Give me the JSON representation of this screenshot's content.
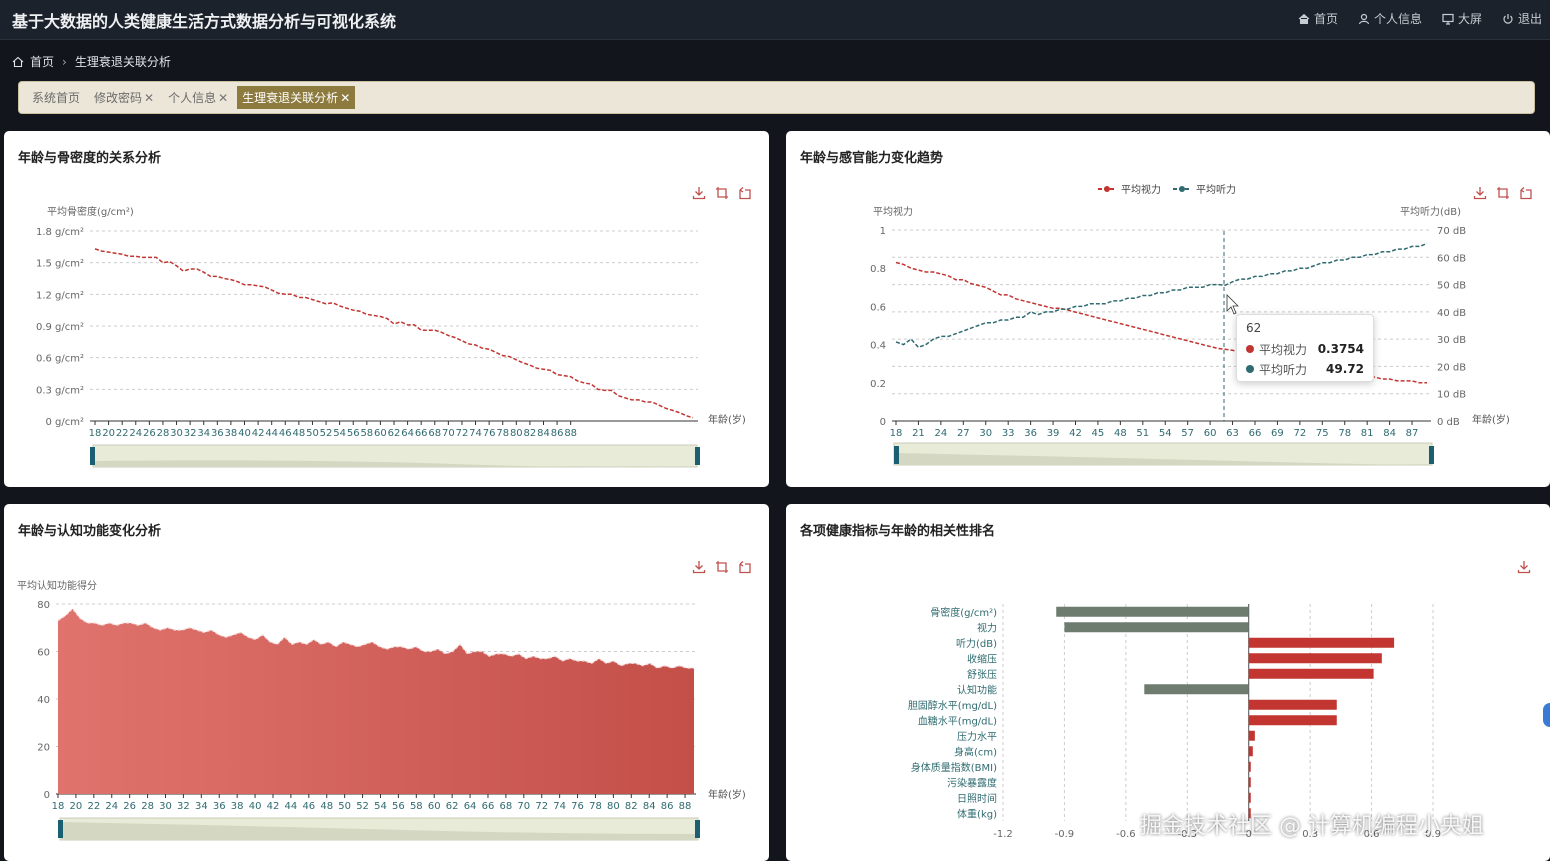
{
  "app": {
    "title": "基于大数据的人类健康生活方式数据分析与可视化系统"
  },
  "topnav": {
    "home": "首页",
    "profile": "个人信息",
    "screen": "大屏",
    "logout": "退出"
  },
  "breadcrumb": {
    "home": "首页",
    "current": "生理衰退关联分析"
  },
  "tabs": [
    {
      "label": "系统首页",
      "closable": false,
      "active": false
    },
    {
      "label": "修改密码",
      "closable": true,
      "active": false
    },
    {
      "label": "个人信息",
      "closable": true,
      "active": false
    },
    {
      "label": "生理衰退关联分析",
      "closable": true,
      "active": true
    }
  ],
  "colors": {
    "red": "#c23531",
    "teal": "#2f6b70",
    "gray": "#6e7c70",
    "area": "#cd5c5c",
    "slider": "#e8ebd7",
    "handle": "#1c5f70"
  },
  "panels": {
    "bone": {
      "title": "年龄与骨密度的关系分析"
    },
    "sense": {
      "title": "年龄与感官能力变化趋势"
    },
    "cog": {
      "title": "年龄与认知功能变化分析"
    },
    "corr": {
      "title": "各项健康指标与年龄的相关性排名"
    }
  },
  "tooltip": {
    "age": "62",
    "vision_name": "平均视力",
    "vision_value": "0.3754",
    "hearing_name": "平均听力",
    "hearing_value": "49.72"
  },
  "watermark": "掘金技术社区 @ 计算机编程小央姐",
  "chart_data": [
    {
      "type": "line",
      "title": "年龄与骨密度的关系分析",
      "xlabel": "年龄(岁)",
      "ylabel": "平均骨密度(g/cm²)",
      "x_start": 18,
      "x_end": 89,
      "x_tick_labels": [
        "18",
        "20",
        "22",
        "24",
        "26",
        "28",
        "30",
        "32",
        "34",
        "36",
        "38",
        "40",
        "42",
        "44",
        "46",
        "48",
        "50",
        "52",
        "54",
        "56",
        "58",
        "60",
        "62",
        "64",
        "66",
        "68",
        "70",
        "72",
        "74",
        "76",
        "78",
        "80",
        "82",
        "84",
        "86",
        "88"
      ],
      "ylim": [
        0,
        1.8
      ],
      "y_tick_labels": [
        "0 g/cm²",
        "0.3 g/cm²",
        "0.6 g/cm²",
        "0.9 g/cm²",
        "1.2 g/cm²",
        "1.5 g/cm²",
        "1.8 g/cm²"
      ],
      "series": [
        {
          "values": [
            1.63,
            1.61,
            1.6,
            1.59,
            1.58,
            1.56,
            1.56,
            1.55,
            1.55,
            1.55,
            1.5,
            1.51,
            1.47,
            1.42,
            1.44,
            1.44,
            1.41,
            1.37,
            1.37,
            1.35,
            1.34,
            1.32,
            1.29,
            1.29,
            1.28,
            1.27,
            1.24,
            1.21,
            1.2,
            1.2,
            1.17,
            1.17,
            1.15,
            1.13,
            1.11,
            1.12,
            1.09,
            1.07,
            1.05,
            1.04,
            1.01,
            1.0,
            0.99,
            0.97,
            0.92,
            0.94,
            0.91,
            0.91,
            0.86,
            0.86,
            0.86,
            0.84,
            0.81,
            0.79,
            0.76,
            0.73,
            0.72,
            0.69,
            0.68,
            0.65,
            0.62,
            0.61,
            0.58,
            0.55,
            0.53,
            0.5,
            0.49,
            0.48,
            0.44,
            0.43,
            0.42,
            0.38,
            0.36,
            0.35,
            0.3,
            0.29,
            0.29,
            0.24,
            0.22,
            0.2,
            0.2,
            0.18,
            0.18,
            0.15,
            0.12,
            0.1,
            0.08,
            0.05,
            0.03
          ]
        }
      ],
      "grid": true
    },
    {
      "type": "line",
      "title": "年龄与感官能力变化趋势",
      "xlabel": "年龄(岁)",
      "ylabel": "平均视力",
      "y2label": "平均听力(dB)",
      "x_start": 18,
      "x_end": 89,
      "x_tick_labels": [
        "18",
        "21",
        "24",
        "27",
        "30",
        "33",
        "36",
        "39",
        "42",
        "45",
        "48",
        "51",
        "54",
        "57",
        "60",
        "63",
        "66",
        "69",
        "72",
        "75",
        "78",
        "81",
        "84",
        "87"
      ],
      "ylim": [
        0,
        1
      ],
      "y_tick_labels": [
        "0",
        "0.2",
        "0.4",
        "0.6",
        "0.8",
        "1"
      ],
      "y2lim": [
        0,
        70
      ],
      "y2_tick_labels": [
        "0 dB",
        "10 dB",
        "20 dB",
        "30 dB",
        "40 dB",
        "50 dB",
        "60 dB",
        "70 dB"
      ],
      "legend": "top-center",
      "series": [
        {
          "name": "平均视力",
          "axis": "left",
          "values": [
            0.83,
            0.82,
            0.8,
            0.79,
            0.78,
            0.78,
            0.77,
            0.76,
            0.74,
            0.74,
            0.72,
            0.71,
            0.7,
            0.68,
            0.66,
            0.66,
            0.64,
            0.63,
            0.62,
            0.61,
            0.6,
            0.59,
            0.59,
            0.58,
            0.57,
            0.56,
            0.55,
            0.54,
            0.53,
            0.52,
            0.51,
            0.5,
            0.49,
            0.48,
            0.47,
            0.46,
            0.45,
            0.44,
            0.43,
            0.42,
            0.41,
            0.4,
            0.39,
            0.38,
            0.3754,
            0.37,
            0.36,
            0.35,
            0.34,
            0.33,
            0.32,
            0.31,
            0.3,
            0.3,
            0.29,
            0.28,
            0.27,
            0.27,
            0.26,
            0.25,
            0.25,
            0.24,
            0.24,
            0.23,
            0.23,
            0.22,
            0.22,
            0.21,
            0.21,
            0.21,
            0.2,
            0.2
          ]
        },
        {
          "name": "平均听力",
          "axis": "right",
          "values": [
            29,
            28,
            30,
            27,
            28,
            30,
            31,
            31,
            32,
            33,
            34,
            35,
            36,
            36,
            37,
            37,
            38,
            38,
            40,
            39,
            40,
            40,
            41,
            41,
            42,
            42,
            43,
            43,
            43,
            44,
            44,
            45,
            45,
            46,
            46,
            47,
            47,
            48,
            48,
            49,
            49,
            49,
            50,
            50,
            49.72,
            51,
            52,
            52,
            53,
            53,
            54,
            54,
            55,
            55,
            56,
            56,
            57,
            58,
            58,
            59,
            59,
            60,
            60,
            61,
            61,
            62,
            62,
            63,
            63,
            64,
            64,
            65
          ]
        }
      ],
      "grid": true
    },
    {
      "type": "area",
      "title": "年龄与认知功能变化分析",
      "xlabel": "年龄(岁)",
      "ylabel": "平均认知功能得分",
      "x_start": 18,
      "x_end": 89,
      "x_tick_labels": [
        "18",
        "20",
        "22",
        "24",
        "26",
        "28",
        "30",
        "32",
        "34",
        "36",
        "38",
        "40",
        "42",
        "44",
        "46",
        "48",
        "50",
        "52",
        "54",
        "56",
        "58",
        "60",
        "62",
        "64",
        "66",
        "68",
        "70",
        "72",
        "74",
        "76",
        "78",
        "80",
        "82",
        "84",
        "86",
        "88"
      ],
      "ylim": [
        0,
        80
      ],
      "y_tick_labels": [
        "0",
        "20",
        "40",
        "60",
        "80"
      ],
      "series": [
        {
          "values": [
            73,
            75,
            78,
            74,
            72,
            72,
            71,
            72,
            71,
            72,
            72,
            71,
            72,
            70,
            69,
            70,
            69,
            69,
            70,
            69,
            68,
            69,
            67,
            66,
            67,
            68,
            66,
            65,
            67,
            64,
            63,
            66,
            63,
            64,
            63,
            65,
            63,
            64,
            62,
            64,
            63,
            62,
            63,
            64,
            62,
            61,
            62,
            62,
            61,
            62,
            60,
            60,
            61,
            59,
            60,
            63,
            59,
            60,
            60,
            58,
            59,
            59,
            58,
            59,
            57,
            58,
            57,
            57,
            58,
            56,
            57,
            56,
            56,
            55,
            57,
            55,
            56,
            54,
            55,
            55,
            54,
            55,
            53,
            54,
            53,
            54,
            53,
            53
          ]
        }
      ],
      "grid": true
    },
    {
      "type": "bar",
      "orientation": "horizontal",
      "title": "各项健康指标与年龄的相关性排名",
      "categories": [
        "骨密度(g/cm²)",
        "视力",
        "听力(dB)",
        "收缩压",
        "舒张压",
        "认知功能",
        "胆固醇水平(mg/dL)",
        "血糖水平(mg/dL)",
        "压力水平",
        "身高(cm)",
        "身体质量指数(BMI)",
        "污染暴露度",
        "日照时间",
        "体重(kg)"
      ],
      "values": [
        -0.94,
        -0.9,
        0.71,
        0.65,
        0.61,
        -0.51,
        0.43,
        0.43,
        0.03,
        0.02,
        0.01,
        0.01,
        0.01,
        0.01
      ],
      "x_tick_labels": [
        "-1.2",
        "-0.9",
        "-0.6",
        "-0.3",
        "0",
        "0.3",
        "0.6",
        "0.9"
      ],
      "xlim": [
        -1.2,
        0.9
      ],
      "grid": true
    }
  ]
}
